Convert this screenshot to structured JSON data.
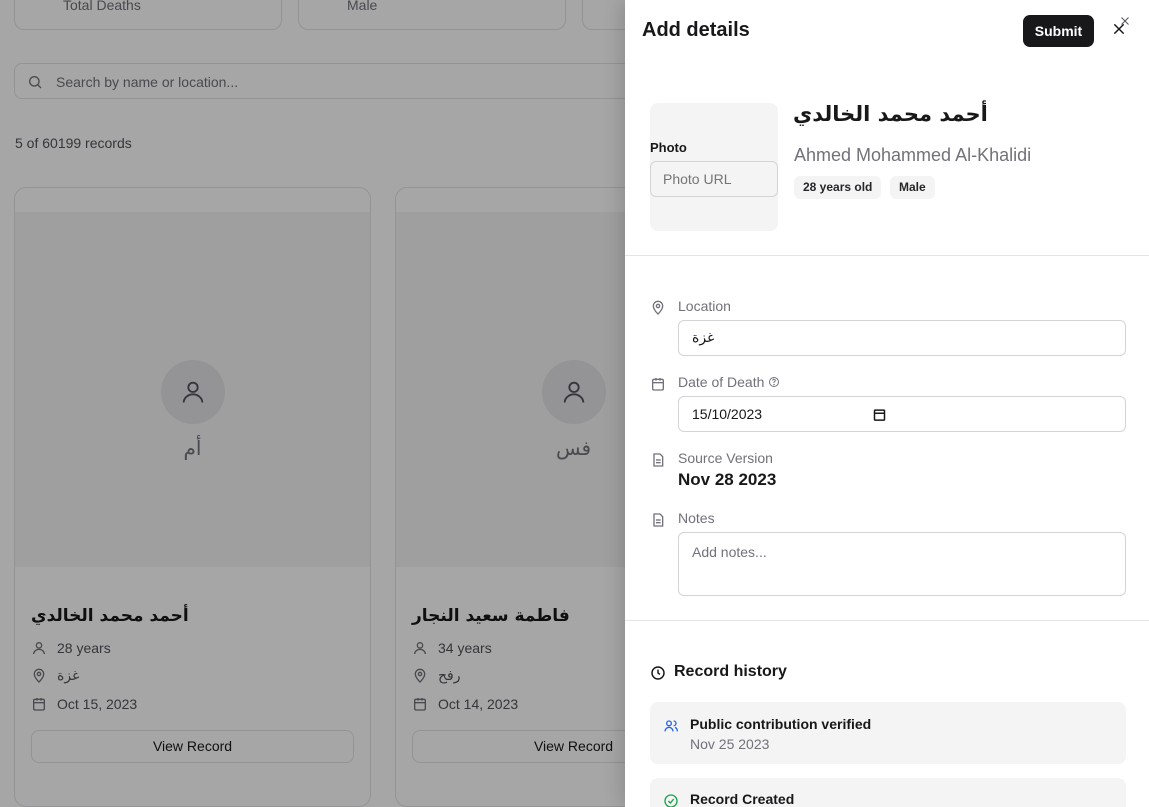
{
  "background": {
    "stats": [
      "Total Deaths",
      "Male"
    ],
    "search_placeholder": "Search by name or location...",
    "record_count": "5 of 60199 records",
    "cards": [
      {
        "initials": "أم",
        "name": "أحمد محمد الخالدي",
        "age": "28 years",
        "location": "غزة",
        "date": "Oct 15, 2023",
        "button": "View Record"
      },
      {
        "initials": "فس",
        "name": "فاطمة سعيد النجار",
        "age": "34 years",
        "location": "رفح",
        "date": "Oct 14, 2023",
        "button": "View Record"
      }
    ]
  },
  "drawer": {
    "title": "Add details",
    "submit_label": "Submit",
    "photo_label": "Photo",
    "photo_placeholder": "Photo URL",
    "name_ar": "أحمد محمد الخالدي",
    "name_en": "Ahmed Mohammed Al-Khalidi",
    "badges": [
      "28 years old",
      "Male"
    ],
    "location_label": "Location",
    "location_value": "غزة",
    "date_label": "Date of Death",
    "date_value": "15/10/2023",
    "source_label": "Source Version",
    "source_value": "Nov 28 2023",
    "notes_label": "Notes",
    "notes_placeholder": "Add notes...",
    "history_title": "Record history",
    "history": [
      {
        "title": "Public contribution verified",
        "date": "Nov 25 2023"
      },
      {
        "title": "Record Created",
        "date": ""
      }
    ]
  }
}
